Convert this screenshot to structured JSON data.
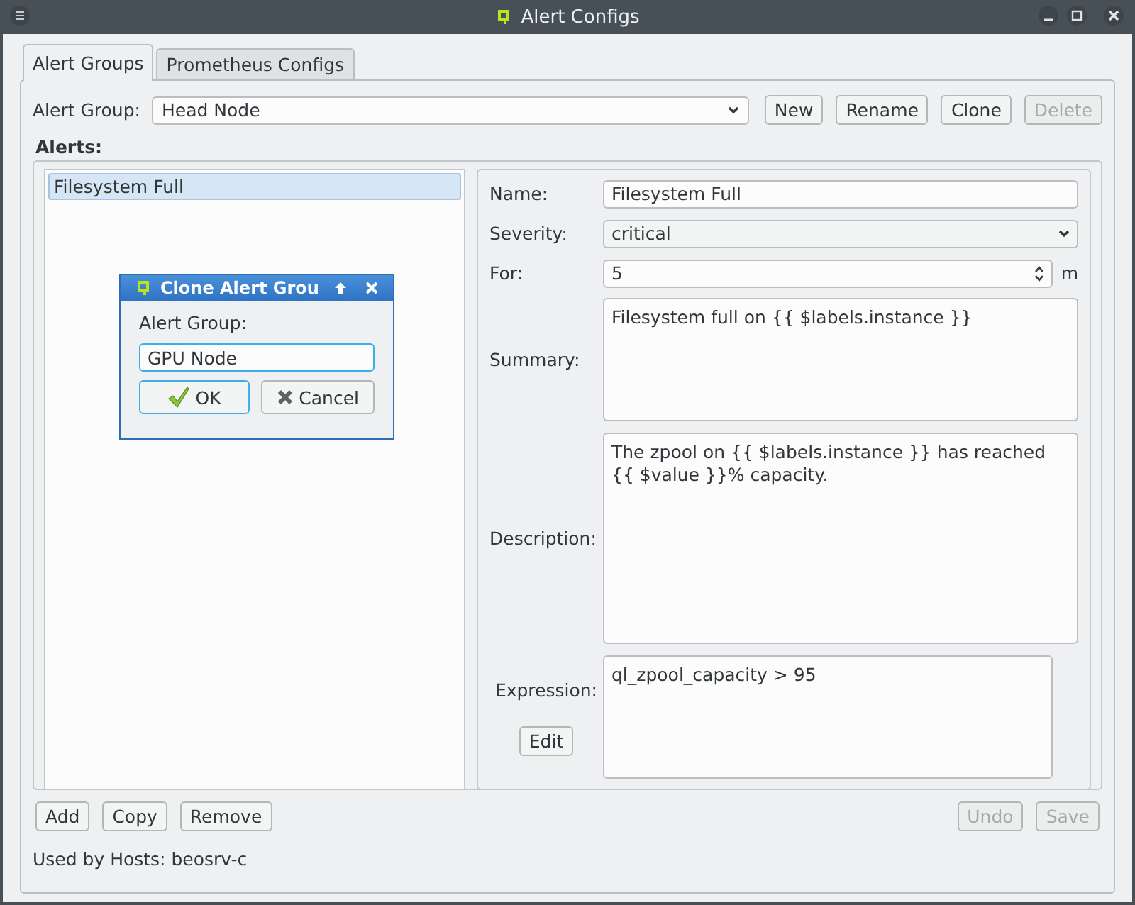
{
  "window": {
    "title": "Alert Configs"
  },
  "tabs": [
    {
      "label": "Alert Groups",
      "selected": true
    },
    {
      "label": "Prometheus Configs",
      "selected": false
    }
  ],
  "alert_group": {
    "label": "Alert Group:",
    "value": "Head Node"
  },
  "group_buttons": [
    {
      "label": "New",
      "disabled": false
    },
    {
      "label": "Rename",
      "disabled": false
    },
    {
      "label": "Clone",
      "disabled": false
    },
    {
      "label": "Delete",
      "disabled": true
    }
  ],
  "alerts_heading": "Alerts:",
  "alerts": [
    {
      "label": "Filesystem Full",
      "selected": true
    }
  ],
  "form": {
    "name_label": "Name:",
    "name": "Filesystem Full",
    "severity_label": "Severity:",
    "severity": "critical",
    "for_label": "For:",
    "for": "5",
    "for_unit": "m",
    "summary_label": "Summary:",
    "summary": "Filesystem full on {{ $labels.instance }}",
    "description_label": "Description:",
    "description": "The zpool on {{ $labels.instance }} has reached {{ $value }}% capacity.",
    "expression_label": "Expression:",
    "expression": "ql_zpool_capacity > 95",
    "edit_button": "Edit"
  },
  "list_buttons": [
    {
      "label": "Add",
      "disabled": false
    },
    {
      "label": "Copy",
      "disabled": false
    },
    {
      "label": "Remove",
      "disabled": false
    }
  ],
  "form_buttons": [
    {
      "label": "Undo",
      "disabled": true
    },
    {
      "label": "Save",
      "disabled": true
    }
  ],
  "used_by": "Used by Hosts: beosrv-c",
  "dialog": {
    "title": "Clone Alert Grou",
    "label": "Alert Group:",
    "value": "GPU Node",
    "ok": "OK",
    "cancel": "Cancel"
  }
}
